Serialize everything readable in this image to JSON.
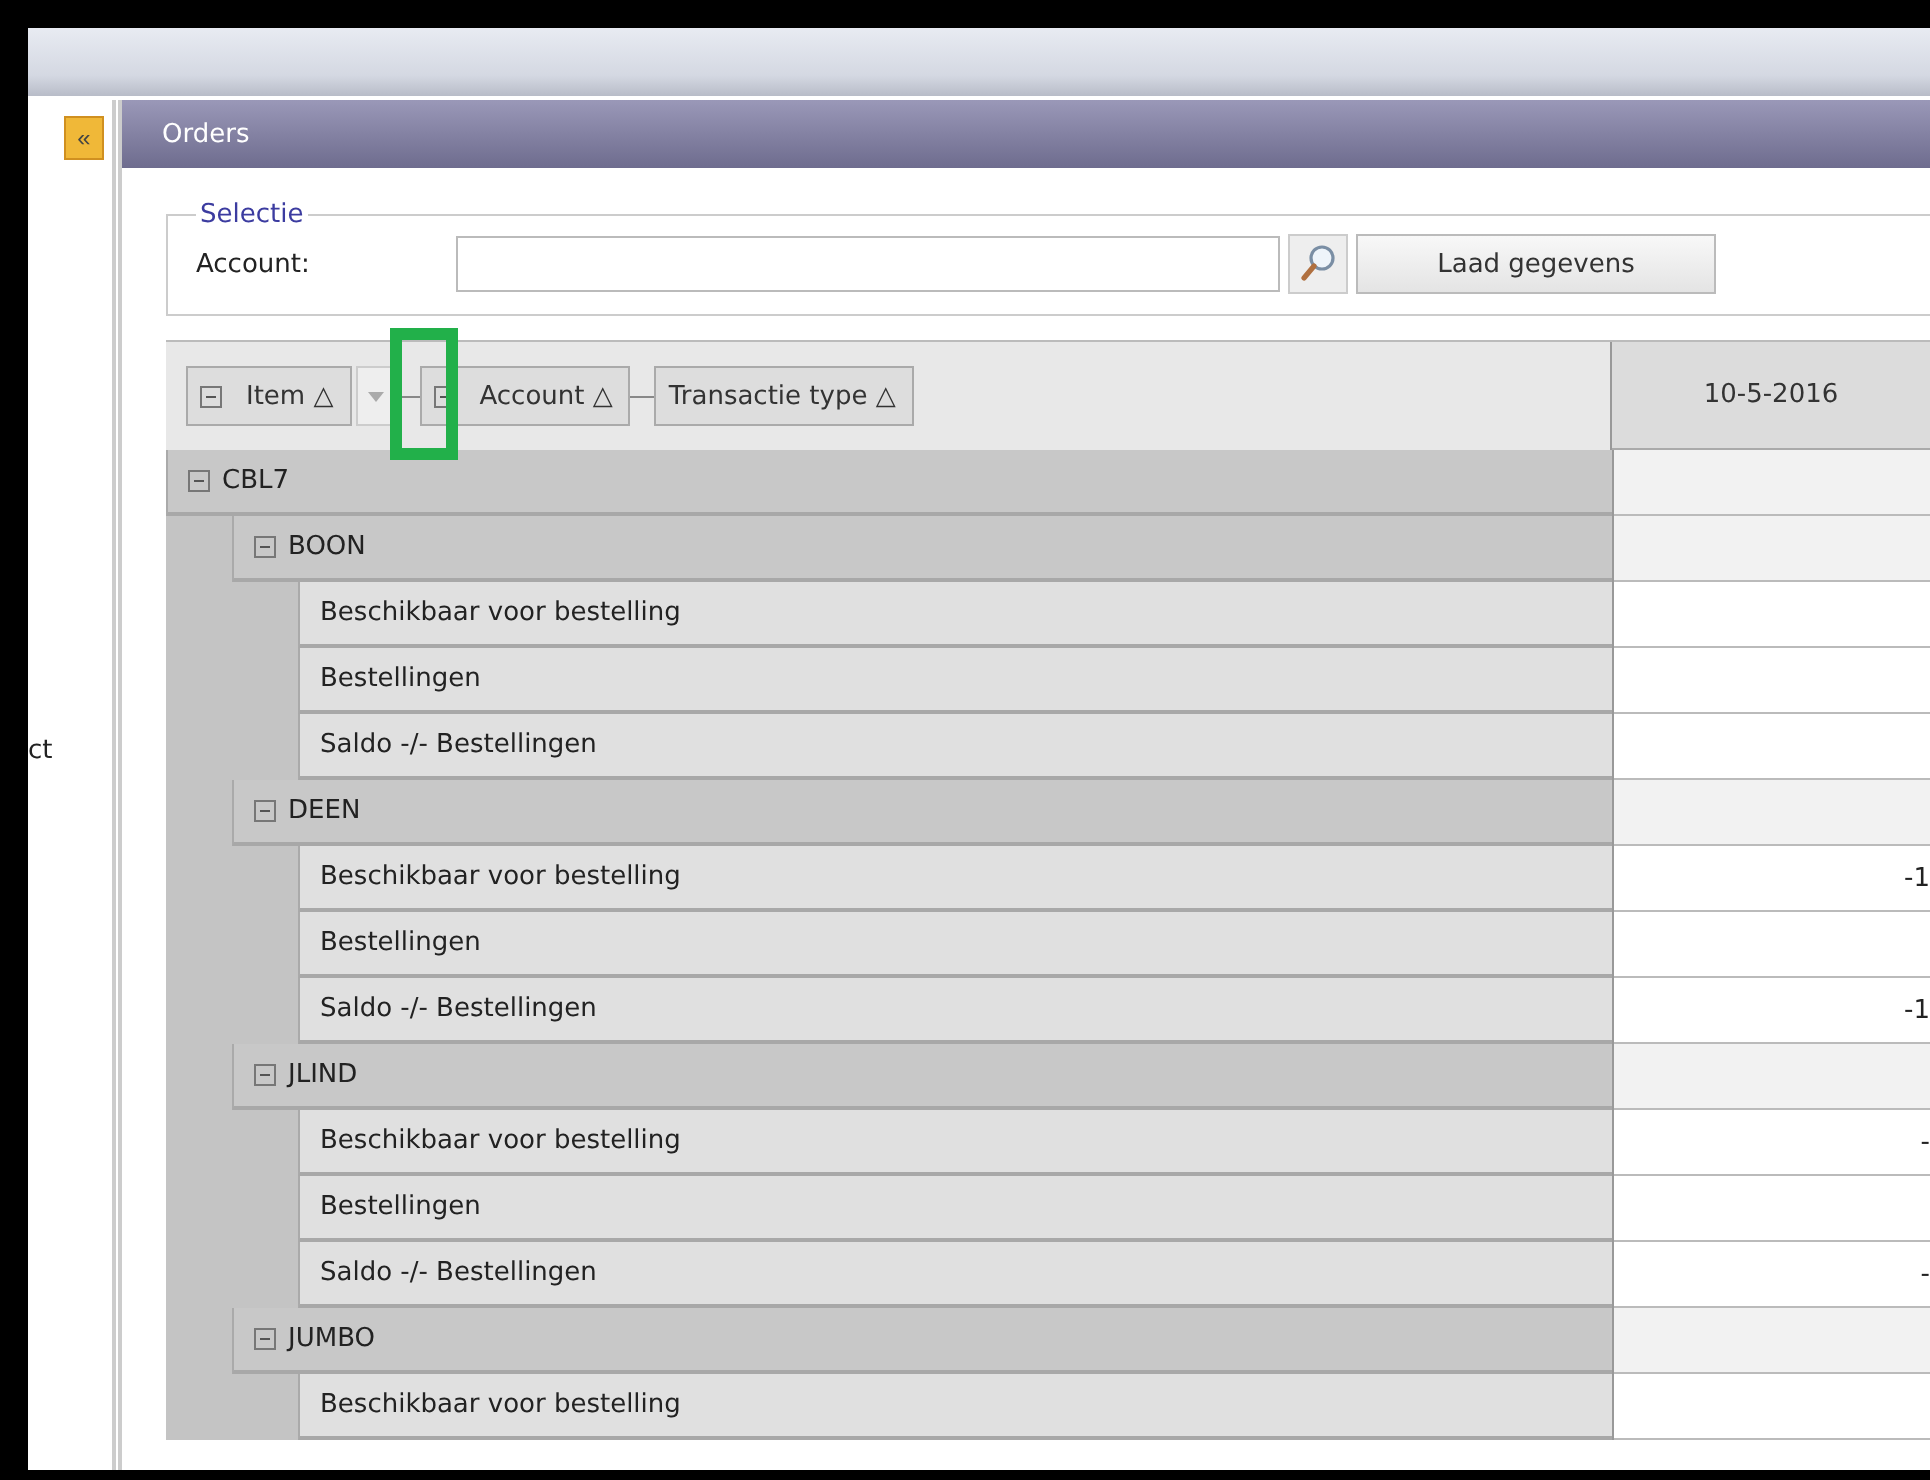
{
  "sidebar": {
    "collapse_button": "«",
    "items": [
      "ct"
    ]
  },
  "panel": {
    "title": "Orders"
  },
  "selection": {
    "legend": "Selectie",
    "account_label": "Account:",
    "load_button": "Laad gegevens"
  },
  "pivot": {
    "row_fields": [
      {
        "label": "Item",
        "kind": "grouped",
        "sort": "△",
        "filter": true
      },
      {
        "label": "Account",
        "kind": "grouped",
        "sort": "△",
        "filter": false
      },
      {
        "label": "Transactie type",
        "kind": "plain",
        "sort": "△",
        "filter": false
      }
    ],
    "columns": [
      "10-5-2016"
    ],
    "rows": [
      {
        "label": "CBL7",
        "expanded": true,
        "children": [
          {
            "label": "BOON",
            "expanded": true,
            "children": [
              {
                "label": "Beschikbaar voor bestelling"
              },
              {
                "label": "Bestellingen"
              },
              {
                "label": "Saldo -/- Bestellingen"
              }
            ]
          },
          {
            "label": "DEEN",
            "expanded": true,
            "children": [
              {
                "label": "Beschikbaar voor bestelling",
                "value": "-1"
              },
              {
                "label": "Bestellingen"
              },
              {
                "label": "Saldo -/- Bestellingen",
                "value": "-1"
              }
            ]
          },
          {
            "label": "JLIND",
            "expanded": true,
            "children": [
              {
                "label": "Beschikbaar voor bestelling",
                "value": "-"
              },
              {
                "label": "Bestellingen"
              },
              {
                "label": "Saldo -/- Bestellingen",
                "value": "-"
              }
            ]
          },
          {
            "label": "JUMBO",
            "expanded": true,
            "children": [
              {
                "label": "Beschikbaar voor bestelling"
              }
            ]
          }
        ]
      }
    ]
  }
}
